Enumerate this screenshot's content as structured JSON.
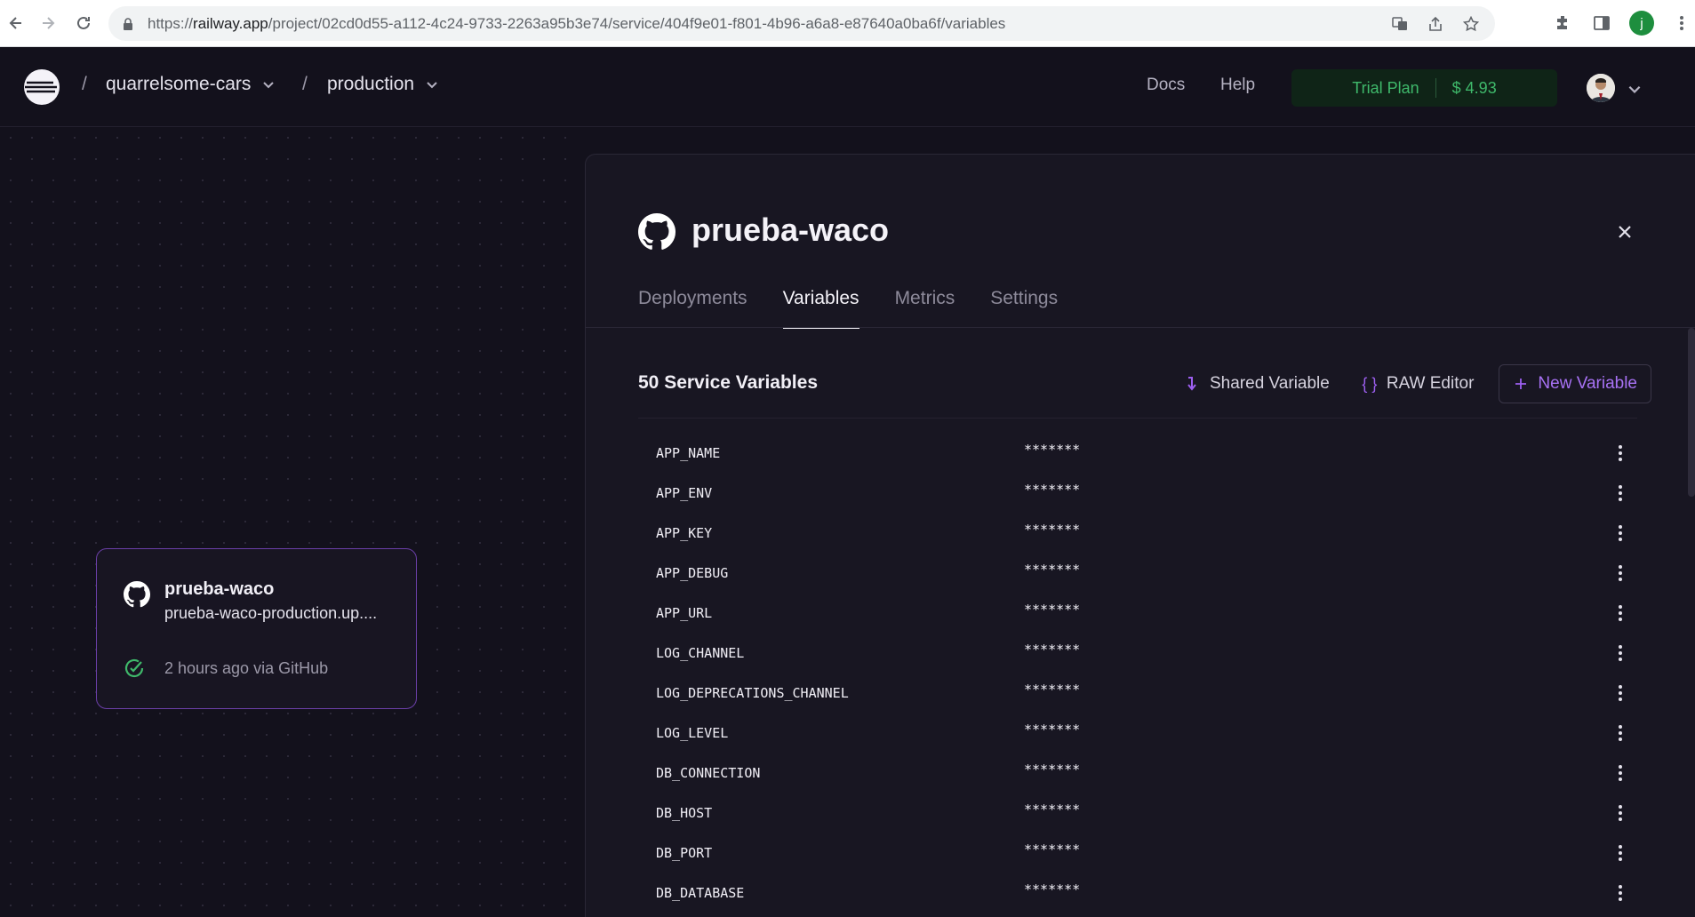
{
  "browser": {
    "url_prefix": "https://",
    "url_domain": "railway.app",
    "url_path": "/project/02cd0d55-a112-4c24-9733-2263a95b3e74/service/404f9e01-f801-4b96-a6a8-e87640a0ba6f/variables",
    "profile_initial": "j"
  },
  "header": {
    "project": "quarrelsome-cars",
    "environment": "production",
    "sep": "/",
    "docs": "Docs",
    "help": "Help",
    "plan": "Trial Plan",
    "balance": "$ 4.93"
  },
  "canvas": {
    "card": {
      "name": "prueba-waco",
      "url": "prueba-waco-production.up....",
      "status": "2 hours ago via GitHub"
    }
  },
  "panel": {
    "title": "prueba-waco",
    "tabs": [
      {
        "label": "Deployments"
      },
      {
        "label": "Variables"
      },
      {
        "label": "Metrics"
      },
      {
        "label": "Settings"
      }
    ],
    "active_tab": "Variables",
    "vars_title": "50 Service Variables",
    "actions": {
      "shared": "Shared Variable",
      "raw": "RAW Editor",
      "new": "New Variable"
    },
    "variables": [
      {
        "key": "APP_NAME",
        "value": "*******"
      },
      {
        "key": "APP_ENV",
        "value": "*******"
      },
      {
        "key": "APP_KEY",
        "value": "*******"
      },
      {
        "key": "APP_DEBUG",
        "value": "*******"
      },
      {
        "key": "APP_URL",
        "value": "*******"
      },
      {
        "key": "LOG_CHANNEL",
        "value": "*******"
      },
      {
        "key": "LOG_DEPRECATIONS_CHANNEL",
        "value": "*******"
      },
      {
        "key": "LOG_LEVEL",
        "value": "*******"
      },
      {
        "key": "DB_CONNECTION",
        "value": "*******"
      },
      {
        "key": "DB_HOST",
        "value": "*******"
      },
      {
        "key": "DB_PORT",
        "value": "*******"
      },
      {
        "key": "DB_DATABASE",
        "value": "*******"
      }
    ]
  },
  "colors": {
    "accent": "#9d5ff0",
    "success": "#3fb96b",
    "background": "#13111c"
  }
}
